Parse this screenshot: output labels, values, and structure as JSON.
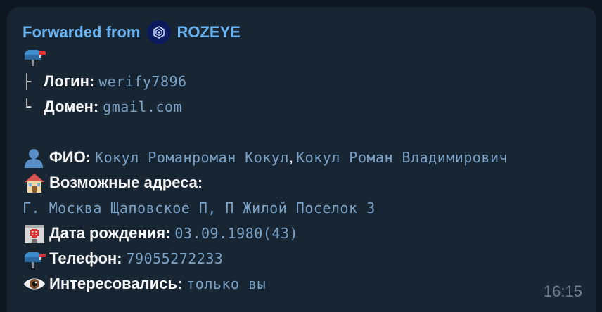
{
  "forward": {
    "prefix": "Forwarded from",
    "channel": "ROZEYE"
  },
  "icons": {
    "mailbox": "mailbox-icon",
    "person": "person-silhouette-icon",
    "house": "house-icon",
    "hospital": "hospital-icon",
    "eye": "eye-icon",
    "channel_logo": "rozeye-logo-icon"
  },
  "account": {
    "login_label": "Логин:",
    "login_value": "werify7896",
    "domain_label": "Домен:",
    "domain_value": "gmail.com",
    "tree_branch": "├",
    "tree_end": "└"
  },
  "person": {
    "fio_label": "ФИО:",
    "fio_value_1": "Кокул Романроман Кокул",
    "fio_separator": ",",
    "fio_value_2": "Кокул Роман Владимирович",
    "address_label": "Возможные адреса:",
    "address_value": "Г. Москва Щаповское П, П Жилой Поселок 3",
    "birth_label": "Дата рождения:",
    "birth_value": "03.09.1980(43)",
    "phone_label": "Телефон:",
    "phone_value": "79055272233",
    "interest_label": "Интересовались:",
    "interest_value": "только вы"
  },
  "message": {
    "time": "16:15"
  },
  "colors": {
    "background": "#0e1621",
    "bubble": "#182533",
    "link": "#6ab3f3",
    "mono": "#7ba2c7"
  }
}
